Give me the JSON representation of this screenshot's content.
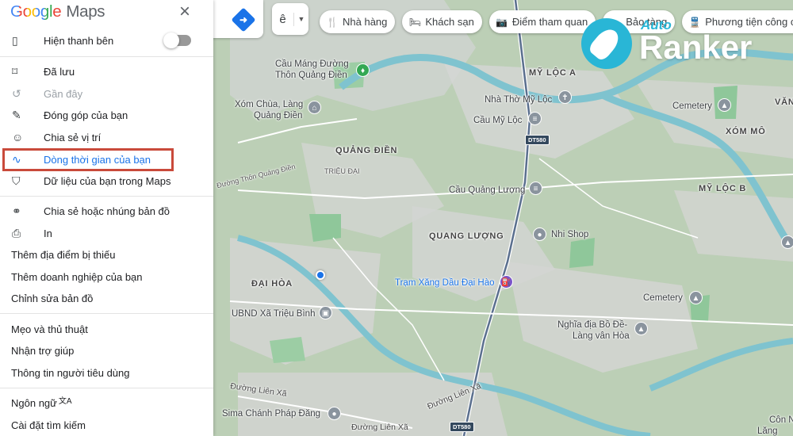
{
  "sidebar": {
    "logo_google": "Google",
    "logo_maps": "Maps",
    "items": [
      {
        "label": "Hiện thanh bên",
        "icon": "sidebar-panel-icon"
      },
      {
        "label": "Đã lưu",
        "icon": "bookmark-icon"
      },
      {
        "label": "Gần đây",
        "icon": "history-icon"
      },
      {
        "label": "Đóng góp của bạn",
        "icon": "edit-note-icon"
      },
      {
        "label": "Chia sẻ vị trí",
        "icon": "share-location-icon"
      },
      {
        "label": "Dòng thời gian của bạn",
        "icon": "timeline-icon"
      },
      {
        "label": "Dữ liệu của bạn trong Maps",
        "icon": "shield-icon"
      },
      {
        "label": "Chia sẻ hoặc nhúng bản đồ",
        "icon": "link-icon"
      },
      {
        "label": "In",
        "icon": "printer-icon"
      },
      {
        "label": "Thêm địa điểm bị thiếu"
      },
      {
        "label": "Thêm doanh nghiệp của bạn"
      },
      {
        "label": "Chỉnh sửa bản đồ"
      },
      {
        "label": "Mẹo và thủ thuật"
      },
      {
        "label": "Nhận trợ giúp"
      },
      {
        "label": "Thông tin người tiêu dùng"
      },
      {
        "label": "Ngôn ngữ",
        "icon": "translate-icon"
      },
      {
        "label": "Cài đặt tìm kiếm"
      }
    ]
  },
  "top": {
    "lang_letter": "ê",
    "chips": [
      {
        "label": "Nhà hàng",
        "icon": "restaurant-icon"
      },
      {
        "label": "Khách sạn",
        "icon": "hotel-icon"
      },
      {
        "label": "Điểm tham quan",
        "icon": "camera-icon"
      },
      {
        "label": "Bảo tàng",
        "icon": "museum-icon"
      },
      {
        "label": "Phương tiện công cộng",
        "icon": "transit-icon"
      }
    ]
  },
  "watermark": {
    "small": "Auto",
    "big": "Ranker"
  },
  "map": {
    "labels": [
      {
        "t": "Cầu Máng Đường",
        "k": "plain"
      },
      {
        "t": "Thôn Quảng Điền",
        "k": "plain"
      },
      {
        "t": "Xóm Chùa, Làng",
        "k": "plain"
      },
      {
        "t": "Quảng Điền",
        "k": "plain"
      },
      {
        "t": "MỸ LỘC A",
        "k": "area"
      },
      {
        "t": "Nhà Thờ Mỹ Lộc",
        "k": "plain"
      },
      {
        "t": "Cầu Mỹ Lộc",
        "k": "plain"
      },
      {
        "t": "Cemetery",
        "k": "plain"
      },
      {
        "t": "XÓM MÔ",
        "k": "area"
      },
      {
        "t": "QUẢNG ĐIỀN",
        "k": "area"
      },
      {
        "t": "TRIỆU ĐẠI",
        "k": "tiny"
      },
      {
        "t": "Cầu Quảng Lượng",
        "k": "plain"
      },
      {
        "t": "MỸ LỘC B",
        "k": "area"
      },
      {
        "t": "QUANG LƯỢNG",
        "k": "area"
      },
      {
        "t": "Nhi Shop",
        "k": "plain"
      },
      {
        "t": "ĐẠI HÒA",
        "k": "area"
      },
      {
        "t": "Trạm Xăng Dầu Đại Hào",
        "k": "blue"
      },
      {
        "t": "Cemetery",
        "k": "plain"
      },
      {
        "t": "UBND Xã Triệu Bình",
        "k": "plain"
      },
      {
        "t": "Nghĩa địa Bồ Đề-",
        "k": "plain"
      },
      {
        "t": "Làng vân Hòa",
        "k": "plain"
      },
      {
        "t": "Đường Liên Xã",
        "k": "road"
      },
      {
        "t": "Đường Liên Xã",
        "k": "road"
      },
      {
        "t": "Sima Chánh Pháp Đăng",
        "k": "plain"
      },
      {
        "t": "Đường Liên Xã",
        "k": "road"
      },
      {
        "t": "Đường Thôn Quảng Điền",
        "k": "tiny"
      },
      {
        "t": "VĂN",
        "k": "area"
      },
      {
        "t": "Côn N",
        "k": "plain"
      },
      {
        "t": "Lăng",
        "k": "plain"
      }
    ],
    "shields": [
      "DT580",
      "DT580"
    ]
  }
}
